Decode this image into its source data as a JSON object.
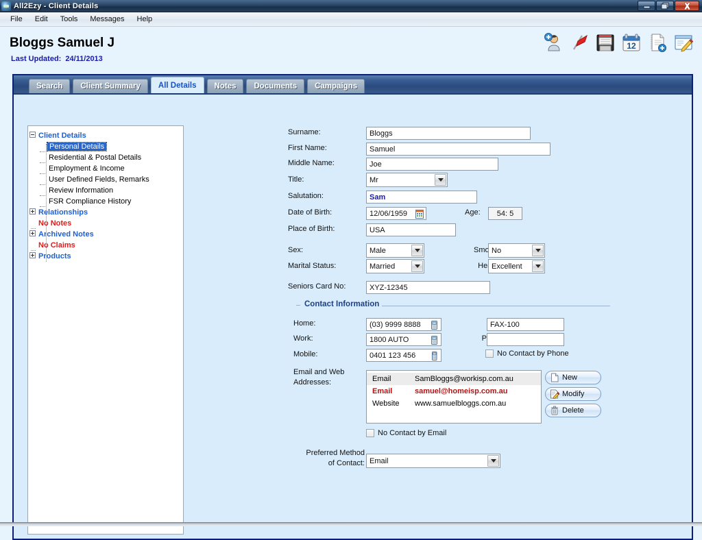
{
  "window": {
    "title": "All2Ezy - Client Details",
    "app_icon": "app-logo-icon",
    "buttons": {
      "minimize": "minimize-icon",
      "maximize": "maximize-icon",
      "close": "close-icon"
    }
  },
  "menubar": {
    "items": [
      "File",
      "Edit",
      "Tools",
      "Messages",
      "Help"
    ]
  },
  "header": {
    "client_name": "Bloggs Samuel J",
    "last_updated_label": "Last Updated:",
    "last_updated_value": "24/11/2013",
    "toolbar_icons": [
      "add-client-icon",
      "red-flag-icon",
      "save-floppy-icon",
      "calendar-icon",
      "new-document-icon",
      "edit-note-icon"
    ]
  },
  "tabs": [
    {
      "label": "Search",
      "active": false
    },
    {
      "label": "Client Summary",
      "active": false
    },
    {
      "label": "All Details",
      "active": true
    },
    {
      "label": "Notes",
      "active": false
    },
    {
      "label": "Documents",
      "active": false
    },
    {
      "label": "Campaigns",
      "active": false
    }
  ],
  "tree": [
    {
      "label": "Client Details",
      "style": "blue",
      "expander": "minus",
      "level": 0
    },
    {
      "label": "Personal Details",
      "style": "selected",
      "expander": "none",
      "level": 1
    },
    {
      "label": "Residential & Postal Details",
      "style": "black",
      "expander": "none",
      "level": 1
    },
    {
      "label": "Employment & Income",
      "style": "black",
      "expander": "none",
      "level": 1
    },
    {
      "label": "User Defined Fields, Remarks",
      "style": "black",
      "expander": "none",
      "level": 1
    },
    {
      "label": "Review Information",
      "style": "black",
      "expander": "none",
      "level": 1
    },
    {
      "label": "FSR Compliance History",
      "style": "black",
      "expander": "none",
      "level": 1
    },
    {
      "label": "Relationships",
      "style": "blue",
      "expander": "plus",
      "level": 0
    },
    {
      "label": "No Notes",
      "style": "red",
      "expander": "none",
      "level": 0
    },
    {
      "label": "Archived Notes",
      "style": "blue",
      "expander": "plus",
      "level": 0
    },
    {
      "label": "No Claims",
      "style": "red",
      "expander": "none",
      "level": 0
    },
    {
      "label": "Products",
      "style": "blue",
      "expander": "plus",
      "level": 0
    }
  ],
  "form": {
    "surname": {
      "label": "Surname:",
      "value": "Bloggs"
    },
    "first_name": {
      "label": "First Name:",
      "value": "Samuel"
    },
    "middle_name": {
      "label": "Middle Name:",
      "value": "Joe"
    },
    "title": {
      "label": "Title:",
      "value": "Mr"
    },
    "salutation": {
      "label": "Salutation:",
      "value": "Sam"
    },
    "date_of_birth": {
      "label": "Date of Birth:",
      "value": "12/06/1959",
      "icon": "calendar-picker-icon"
    },
    "age": {
      "label": "Age:",
      "value": "54: 5"
    },
    "place_of_birth": {
      "label": "Place of Birth:",
      "value": "USA"
    },
    "sex": {
      "label": "Sex:",
      "value": "Male"
    },
    "smoker": {
      "label": "Smoker:",
      "value": "No"
    },
    "marital_status": {
      "label": "Marital Status:",
      "value": "Married"
    },
    "health": {
      "label": "Health:",
      "value": "Excellent"
    },
    "seniors_card": {
      "label": "Seniors Card No:",
      "value": "XYZ-12345"
    }
  },
  "contact": {
    "group_title": "Contact Information",
    "home": {
      "label": "Home:",
      "value": "(03) 9999 8888",
      "icon": "phone-icon"
    },
    "work": {
      "label": "Work:",
      "value": "1800 AUTO",
      "icon": "phone-icon"
    },
    "mobile": {
      "label": "Mobile:",
      "value": "0401 123 456",
      "icon": "mobile-phone-icon"
    },
    "fax": {
      "label": "Fax:",
      "value": "FAX-100"
    },
    "pager": {
      "label": "Pager:",
      "value": ""
    },
    "no_contact_by_phone": {
      "label": "No Contact by Phone",
      "checked": false
    },
    "email_label_line1": "Email and Web",
    "email_label_line2": "Addresses:",
    "email_rows": [
      {
        "kind": "Email",
        "value": "SamBloggs@workisp.com.au",
        "style": "selected"
      },
      {
        "kind": "Email",
        "value": "samuel@homeisp.com.au",
        "style": "red"
      },
      {
        "kind": "Website",
        "value": "www.samuelbloggs.com.au",
        "style": "normal"
      }
    ],
    "buttons": [
      {
        "label": "New",
        "icon": "new-page-icon"
      },
      {
        "label": "Modify",
        "icon": "edit-pencil-icon"
      },
      {
        "label": "Delete",
        "icon": "trash-icon"
      }
    ],
    "no_contact_by_email": {
      "label": "No Contact by Email",
      "checked": false
    },
    "preferred_method": {
      "label_line1": "Preferred Method",
      "label_line2": "of Contact:",
      "value": "Email"
    }
  }
}
